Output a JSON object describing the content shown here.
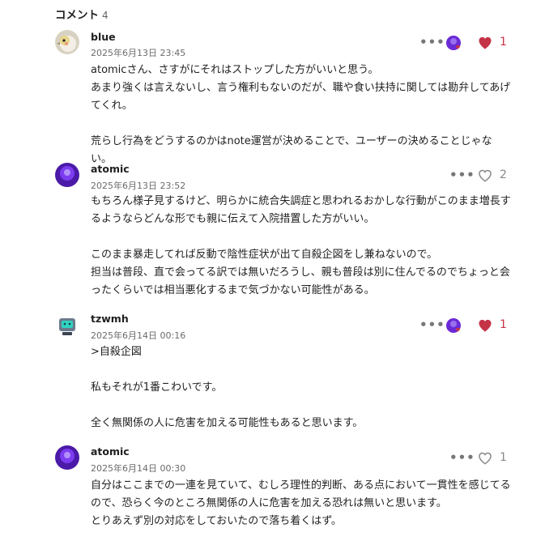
{
  "header": {
    "title": "コメント",
    "count": "4"
  },
  "comments": [
    {
      "name": "blue",
      "date": "2025年6月13日 23:45",
      "likes": "1",
      "liked": true,
      "paragraphs": [
        "atomicさん、さすがにそれはストップした方がいいと思う。",
        "あまり強くは言えないし、言う権利もないのだが、職や食い扶持に関しては勘弁してあげてくれ。",
        "",
        "荒らし行為をどうするのかはnote運営が決めることで、ユーザーの決めることじゃない。"
      ]
    },
    {
      "name": "atomic",
      "date": "2025年6月13日 23:52",
      "likes": "2",
      "liked": false,
      "paragraphs": [
        "もちろん様子見するけど、明らかに統合失調症と思われるおかしな行動がこのまま増長するようならどんな形でも親に伝えて入院措置した方がいい。",
        "",
        "このまま暴走してれば反動で陰性症状が出て自殺企図をし兼ねないので。",
        "担当は普段、直で会ってる訳では無いだろうし、親も普段は別に住んでるのでちょっと会ったくらいでは相当悪化するまで気づかない可能性がある。"
      ]
    },
    {
      "name": "tzwmh",
      "date": "2025年6月14日 00:16",
      "likes": "1",
      "liked": true,
      "paragraphs": [
        ">自殺企図",
        "",
        "私もそれが1番こわいです。",
        "",
        "全く無関係の人に危害を加える可能性もあると思います。"
      ]
    },
    {
      "name": "atomic",
      "date": "2025年6月14日 00:30",
      "likes": "1",
      "liked": false,
      "paragraphs": [
        "自分はここまでの一連を見ていて、むしろ理性的判断、ある点において一貫性を感じてるので、恐らく今のところ無関係の人に危害を加える恐れは無いと思います。",
        "とりあえず別の対応をしておいたので落ち着くはず。"
      ]
    }
  ],
  "icons": {
    "more": "more-horizontal-icon",
    "heart_filled": "heart-filled-icon",
    "heart_outline": "heart-outline-icon"
  },
  "colors": {
    "liked_heart": "#c53347",
    "unliked_heart": "#888888",
    "avatar_purple": "#6a2bd6"
  }
}
